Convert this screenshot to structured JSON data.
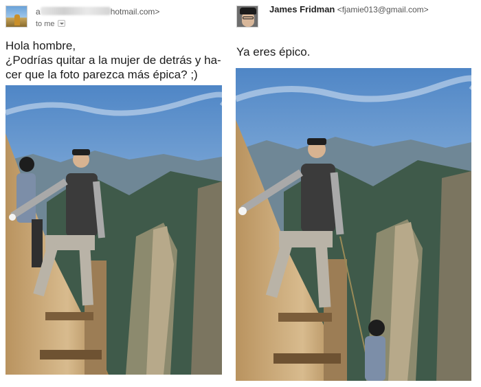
{
  "left_email": {
    "sender_suffix": "hotmail.com>",
    "recipient_label": "to me",
    "message_lines": [
      "Hola hombre,",
      "¿Podrías quitar a la mujer de detrás y ha-",
      "cer que la foto parezca más épica? ;)"
    ]
  },
  "right_email": {
    "sender_name": "James Fridman",
    "sender_address": "<fjamie013@gmail.com>",
    "message": "Ya eres épico."
  },
  "icons": {
    "left_avatar": "profile-photo-icon",
    "right_avatar": "profile-photo-icon",
    "recipient_dropdown": "chevron-down-icon"
  },
  "colors": {
    "sky_top": "#4f86c6",
    "sky_bottom": "#cfe0ee",
    "rock": "#c9a779",
    "mountain": "#3f5a4a"
  }
}
